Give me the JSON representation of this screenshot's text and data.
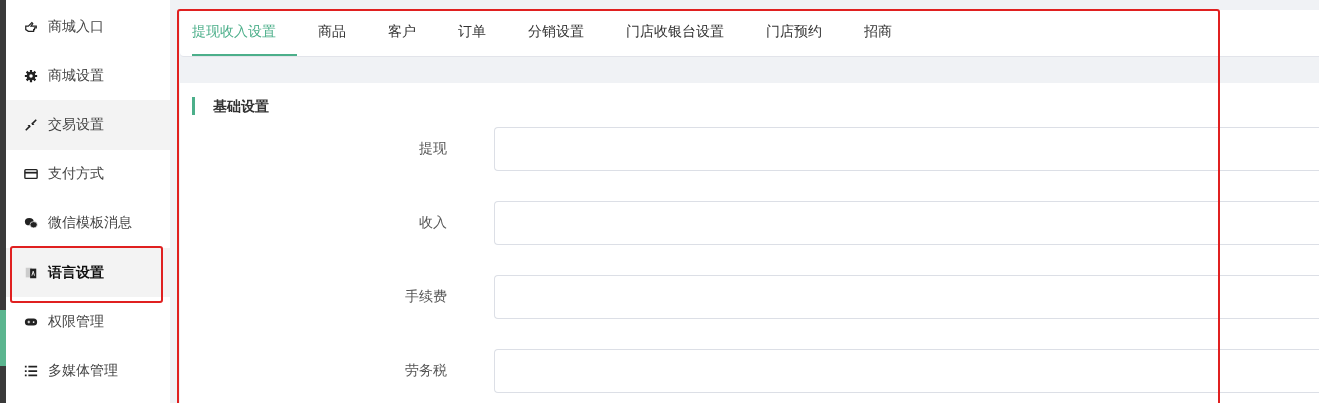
{
  "sidebar": {
    "items": [
      {
        "label": "商城入口",
        "selected": false,
        "hovered": false
      },
      {
        "label": "商城设置",
        "selected": false,
        "hovered": false
      },
      {
        "label": "交易设置",
        "selected": false,
        "hovered": true
      },
      {
        "label": "支付方式",
        "selected": false,
        "hovered": false
      },
      {
        "label": "微信模板消息",
        "selected": false,
        "hovered": false
      },
      {
        "label": "语言设置",
        "selected": true,
        "hovered": false
      },
      {
        "label": "权限管理",
        "selected": false,
        "hovered": false
      },
      {
        "label": "多媒体管理",
        "selected": false,
        "hovered": false
      }
    ]
  },
  "tabs": [
    {
      "label": "提现收入设置",
      "selected": true
    },
    {
      "label": "商品",
      "selected": false
    },
    {
      "label": "客户",
      "selected": false
    },
    {
      "label": "订单",
      "selected": false
    },
    {
      "label": "分销设置",
      "selected": false
    },
    {
      "label": "门店收银台设置",
      "selected": false
    },
    {
      "label": "门店预约",
      "selected": false
    },
    {
      "label": "招商",
      "selected": false
    }
  ],
  "section": {
    "title": "基础设置"
  },
  "form": {
    "fields": [
      {
        "label": "提现"
      },
      {
        "label": "收入"
      },
      {
        "label": "手续费"
      },
      {
        "label": "劳务税"
      }
    ]
  }
}
